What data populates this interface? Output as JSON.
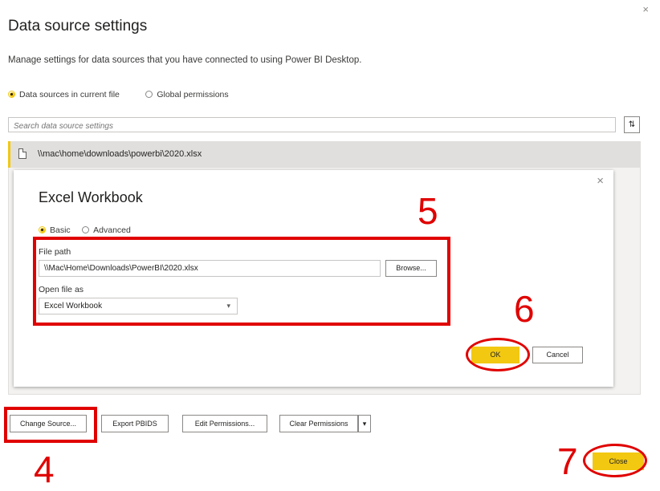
{
  "window": {
    "title": "Data source settings",
    "description": "Manage settings for data sources that you have connected to using Power BI Desktop.",
    "close_glyph": "×"
  },
  "scope": {
    "options": [
      {
        "label": "Data sources in current file",
        "selected": true
      },
      {
        "label": "Global permissions",
        "selected": false
      }
    ]
  },
  "search": {
    "placeholder": "Search data source settings",
    "sort_glyph": "⇅"
  },
  "sources": [
    {
      "path": "\\\\mac\\home\\downloads\\powerbi\\2020.xlsx",
      "icon": "file-icon",
      "selected": true
    }
  ],
  "dialog": {
    "title": "Excel Workbook",
    "close_glyph": "×",
    "modes": [
      {
        "label": "Basic",
        "selected": true
      },
      {
        "label": "Advanced",
        "selected": false
      }
    ],
    "file_path_label": "File path",
    "file_path_value": "\\\\Mac\\Home\\Downloads\\PowerBI\\2020.xlsx",
    "browse_label": "Browse...",
    "open_as_label": "Open file as",
    "open_as_value": "Excel Workbook",
    "ok_label": "OK",
    "cancel_label": "Cancel"
  },
  "footer": {
    "change_source_label": "Change Source...",
    "export_label": "Export PBIDS",
    "edit_permissions_label": "Edit Permissions...",
    "clear_permissions_label": "Clear Permissions",
    "clear_caret": "▾",
    "close_label": "Close"
  },
  "annotations": {
    "step4": "4",
    "step5": "5",
    "step6": "6",
    "step7": "7",
    "color": "#e00000"
  },
  "colors": {
    "accent": "#f2c811"
  }
}
